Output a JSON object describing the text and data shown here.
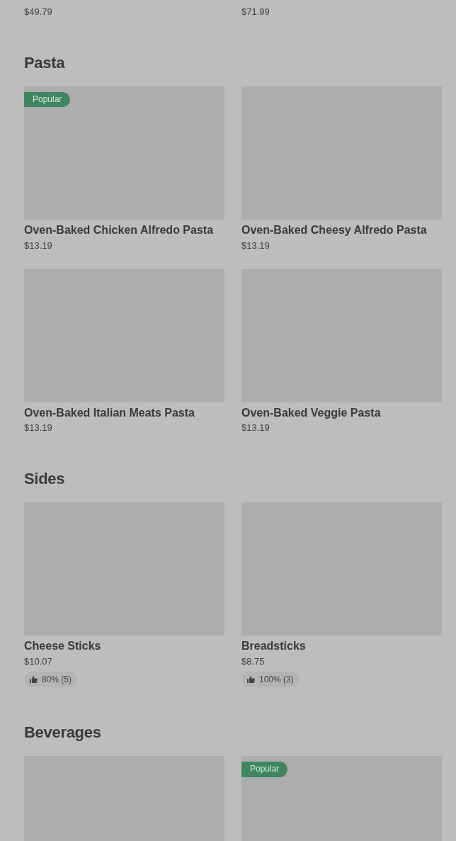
{
  "sections": [
    {
      "items": [
        {
          "price": "$49.79"
        },
        {
          "price": "$71.99"
        }
      ]
    },
    {
      "title": "Pasta",
      "items": [
        {
          "name": "Oven-Baked Chicken Alfredo Pasta",
          "price": "$13.19",
          "popular": true,
          "badge": "Popular"
        },
        {
          "name": "Oven-Baked Cheesy Alfredo Pasta",
          "price": "$13.19",
          "popular": false
        },
        {
          "name": "Oven-Baked Italian Meats Pasta",
          "price": "$13.19",
          "popular": false
        },
        {
          "name": "Oven-Baked Veggie Pasta",
          "price": "$13.19",
          "popular": false
        }
      ]
    },
    {
      "title": "Sides",
      "items": [
        {
          "name": "Cheese Sticks",
          "price": "$10.07",
          "popular": false,
          "rating": "80% (5)"
        },
        {
          "name": "Breadsticks",
          "price": "$8.75",
          "popular": false,
          "rating": "100% (3)"
        }
      ]
    },
    {
      "title": "Beverages",
      "items": [
        {
          "popular": false
        },
        {
          "popular": true,
          "badge": "Popular"
        }
      ]
    }
  ]
}
